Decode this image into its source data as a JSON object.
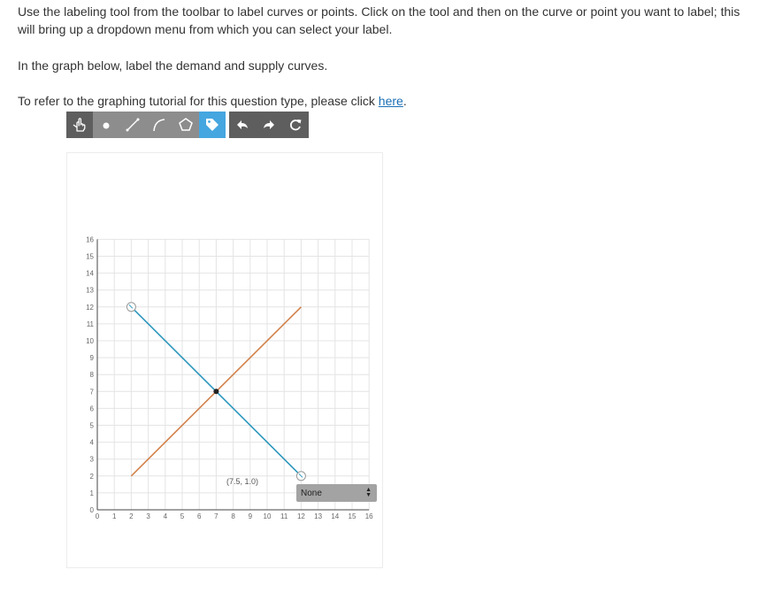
{
  "instructions": {
    "line1": "Use the labeling tool from the toolbar to label curves or points.  Click on the tool and then on the curve or point you want to label; this will bring up a dropdown menu from which you can select your label.",
    "line2": "In the graph below, label the demand and supply curves.",
    "line3_prefix": "To refer to the graphing tutorial for this question type, please click ",
    "link_text": "here",
    "line3_suffix": "."
  },
  "toolbar": {
    "tools": [
      "pointer-tool",
      "point-tool",
      "line-tool",
      "curve-tool",
      "polygon-tool",
      "label-tool"
    ],
    "active_tool": "label-tool",
    "actions": [
      "undo",
      "redo",
      "reset"
    ],
    "colors": {
      "button": "#8d8d8d",
      "dark": "#5e5e5e",
      "active": "#45a6e0"
    }
  },
  "graph": {
    "coordinate_readout": "(7.5, 1.0)",
    "label_dropdown": {
      "selected": "None"
    },
    "axis_ticks": {
      "x": [
        "0",
        "1",
        "2",
        "3",
        "4",
        "5",
        "6",
        "7",
        "8",
        "9",
        "10",
        "11",
        "12",
        "13",
        "14",
        "15",
        "16"
      ],
      "y": [
        "0",
        "1",
        "2",
        "3",
        "4",
        "5",
        "6",
        "7",
        "8",
        "9",
        "10",
        "11",
        "12",
        "13",
        "14",
        "15",
        "16"
      ]
    }
  },
  "chart_data": {
    "type": "line",
    "xlim": [
      0,
      16
    ],
    "ylim": [
      0,
      16
    ],
    "grid": true,
    "series": [
      {
        "color": "#2d97bd",
        "points": [
          [
            2,
            12
          ],
          [
            12,
            2
          ]
        ]
      },
      {
        "color": "#d3814a",
        "points": [
          [
            2,
            2
          ],
          [
            12,
            12
          ]
        ]
      }
    ],
    "intersection": [
      7,
      7
    ]
  }
}
